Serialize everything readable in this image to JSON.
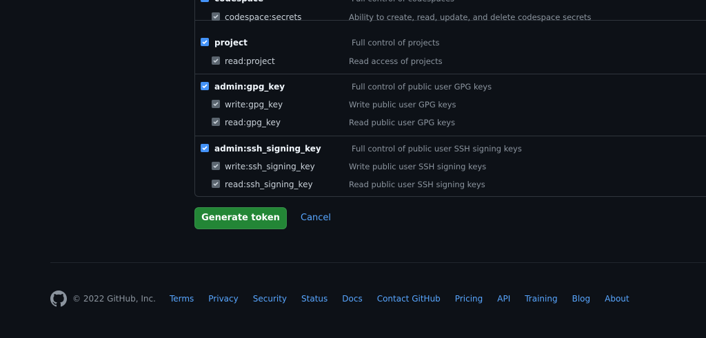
{
  "scope_groups": [
    {
      "parent": {
        "name": "codespace",
        "description": "Full control of codespaces"
      },
      "children": [
        {
          "name": "codespace:secrets",
          "description": "Ability to create, read, update, and delete codespace secrets"
        }
      ]
    },
    {
      "parent": {
        "name": "project",
        "description": "Full control of projects"
      },
      "children": [
        {
          "name": "read:project",
          "description": "Read access of projects"
        }
      ]
    },
    {
      "parent": {
        "name": "admin:gpg_key",
        "description": "Full control of public user GPG keys"
      },
      "children": [
        {
          "name": "write:gpg_key",
          "description": "Write public user GPG keys"
        },
        {
          "name": "read:gpg_key",
          "description": "Read public user GPG keys"
        }
      ]
    },
    {
      "parent": {
        "name": "admin:ssh_signing_key",
        "description": "Full control of public user SSH signing keys"
      },
      "children": [
        {
          "name": "write:ssh_signing_key",
          "description": "Write public user SSH signing keys"
        },
        {
          "name": "read:ssh_signing_key",
          "description": "Read public user SSH signing keys"
        }
      ]
    }
  ],
  "actions": {
    "generate_label": "Generate token",
    "cancel_label": "Cancel"
  },
  "footer": {
    "logo_icon": "github-mark-icon",
    "copyright": "© 2022 GitHub, Inc.",
    "links": [
      "Terms",
      "Privacy",
      "Security",
      "Status",
      "Docs",
      "Contact GitHub",
      "Pricing",
      "API",
      "Training",
      "Blog",
      "About"
    ]
  },
  "colors": {
    "background": "#0d1117",
    "primary_button": "#238636",
    "link": "#58a6ff",
    "checkbox_checked": "#4493f8",
    "checkbox_inherited": "#5c6670"
  }
}
